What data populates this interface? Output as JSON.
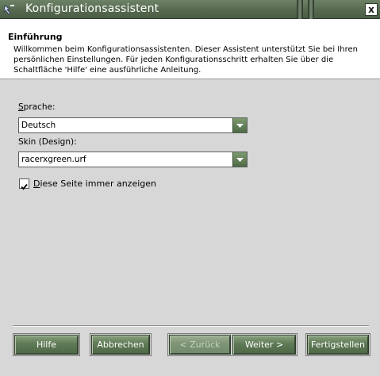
{
  "window": {
    "title": "Konfigurationsassistent",
    "close_glyph": "x"
  },
  "header": {
    "heading": "Einführung",
    "description": "Willkommen beim Konfigurationsassistenten. Dieser Assistent unterstützt Sie bei Ihren persönlichen Einstellungen. Für jeden Konfigurationsschritt erhalten Sie über die Schaltfläche 'Hilfe' eine ausführliche Anleitung."
  },
  "form": {
    "language_label": "Sprache:",
    "language_value": "Deutsch",
    "skin_label": "Skin (Design):",
    "skin_value": "racerxgreen.urf",
    "always_show_label": "Diese Seite immer anzeigen",
    "always_show_checked": true
  },
  "buttons": {
    "help": "Hilfe",
    "cancel": "Abbrechen",
    "back": "< Zurück",
    "next": "Weiter >",
    "finish": "Fertigstellen"
  },
  "colors": {
    "titlebar": "#566a50",
    "button": "#5f7a56",
    "window_bg": "#d7d7d7"
  },
  "icons": {
    "app": "wizard-icon",
    "close": "close-icon",
    "dropdown": "chevron-down-icon",
    "check": "checkmark-icon"
  }
}
